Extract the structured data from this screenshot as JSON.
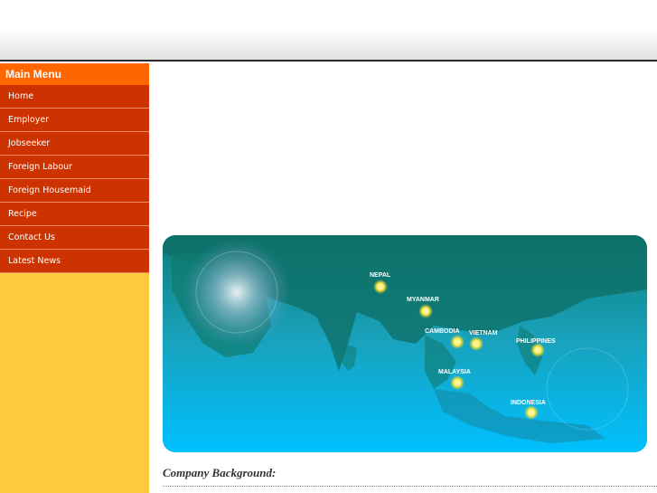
{
  "sidebar": {
    "title": "Main Menu",
    "items": [
      {
        "label": "Home"
      },
      {
        "label": "Employer"
      },
      {
        "label": "Jobseeker"
      },
      {
        "label": "Foreign Labour"
      },
      {
        "label": "Foreign Housemaid"
      },
      {
        "label": "Recipe"
      },
      {
        "label": "Contact Us"
      },
      {
        "label": "Latest News"
      }
    ]
  },
  "map": {
    "countries": [
      {
        "name": "NEPAL"
      },
      {
        "name": "MYANMAR"
      },
      {
        "name": "CAMBODIA"
      },
      {
        "name": "VIETNAM"
      },
      {
        "name": "PHILIPPINES"
      },
      {
        "name": "MALAYSIA"
      },
      {
        "name": "INDONESIA"
      }
    ]
  },
  "content": {
    "heading": "Company Background:"
  },
  "colors": {
    "menu_title_bg": "#ff6600",
    "menu_item_bg": "#cc3300",
    "sidebar_bg": "#fec93a",
    "map_top": "#0e7a76",
    "map_bottom": "#00bfff"
  }
}
